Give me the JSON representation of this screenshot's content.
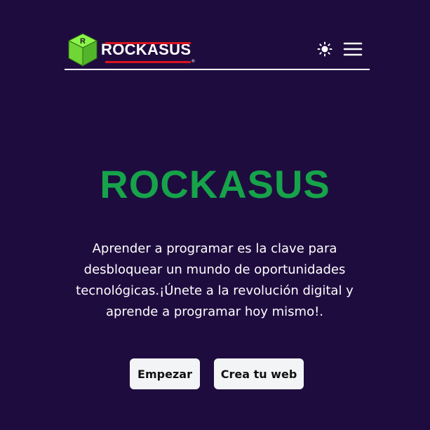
{
  "header": {
    "logo_text": "ROCKASUS",
    "logo_letter": "R",
    "logo_reg": "®",
    "theme_icon": "sun-icon",
    "menu_icon": "hamburger-menu-icon"
  },
  "hero": {
    "title": "ROCKASUS",
    "description": "Aprender a programar es la clave para desbloquear un mundo de oportunidades tecnológicas.¡Únete a la revolución digital y aprende a programar hoy mismo!.",
    "primary_button": "Empezar",
    "secondary_button": "Crea tu web"
  },
  "colors": {
    "background": "#1f0c3f",
    "title_green": "#16a34a",
    "logo_red": "#d8141e",
    "logo_cube_green": "#7ae83a",
    "button_bg": "#f3f4f6"
  }
}
